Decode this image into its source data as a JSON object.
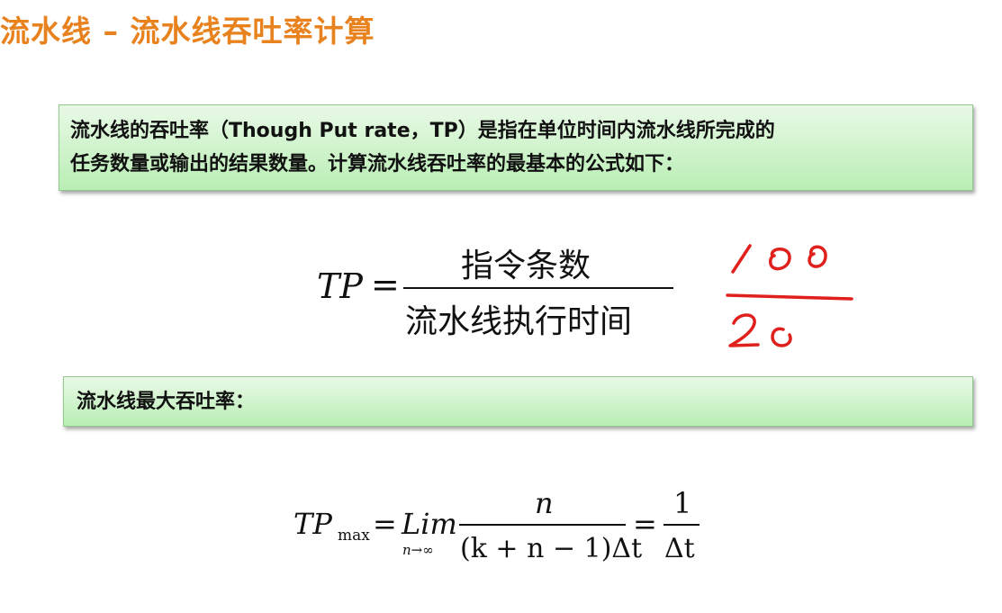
{
  "page_title": "流水线 – 流水线吞吐率计算",
  "definition": {
    "line1": "流水线的吞吐率（Though Put rate，TP）是指在单位时间内流水线所完成的",
    "line2": "任务数量或输出的结果数量。计算流水线吞吐率的最基本的公式如下："
  },
  "formula1": {
    "lhs": "TP",
    "equals": "=",
    "numerator": "指令条数",
    "denominator": "流水线执行时间"
  },
  "handwritten": {
    "numerator": "100",
    "denominator": "20",
    "color": "#e0201c"
  },
  "max_label": "流水线最大吞吐率：",
  "formula2": {
    "lhs_main": "TP",
    "lhs_sub": "max",
    "equals1": "=",
    "lim": "Lim",
    "lim_sub": "n→∞",
    "frac1_num": "n",
    "frac1_den": "(k + n − 1)Δt",
    "equals2": "=",
    "frac2_num": "1",
    "frac2_den": "Δt"
  }
}
